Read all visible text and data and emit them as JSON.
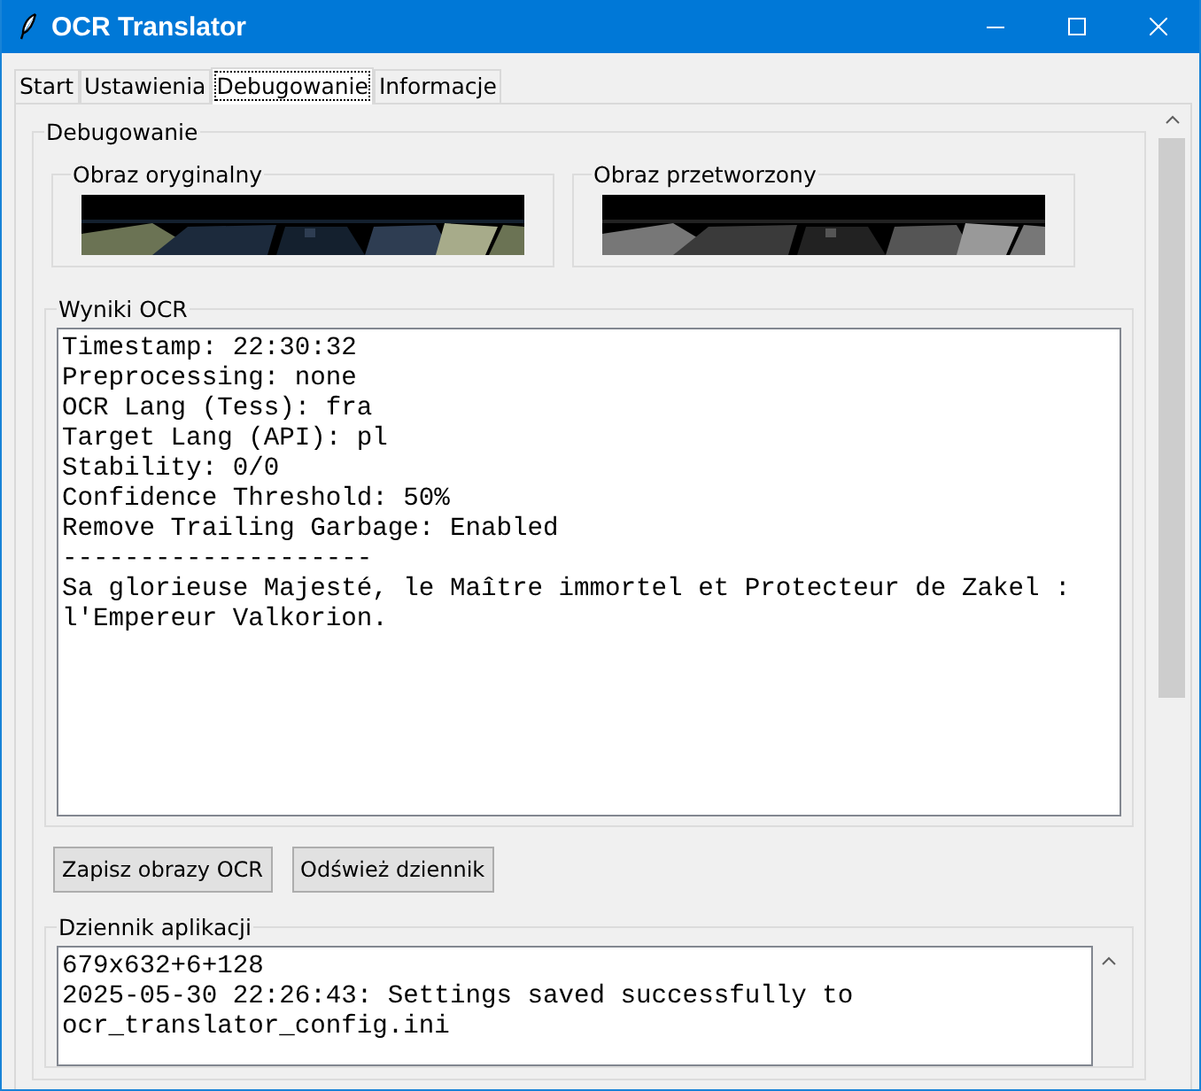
{
  "window": {
    "title": "OCR Translator"
  },
  "tabs": [
    {
      "label": "Start",
      "selected": false
    },
    {
      "label": "Ustawienia",
      "selected": false
    },
    {
      "label": "Debugowanie",
      "selected": true
    },
    {
      "label": "Informacje",
      "selected": false
    }
  ],
  "debug_group": {
    "title": "Debugowanie",
    "previews": [
      {
        "title": "Obraz oryginalny",
        "kind": "picture",
        "grayscale": false
      },
      {
        "title": "Obraz przetworzony",
        "kind": "picture",
        "grayscale": true
      }
    ]
  },
  "ocr_results": {
    "title": "Wyniki OCR",
    "lines": [
      "Timestamp: 22:30:32",
      "Preprocessing: none",
      "OCR Lang (Tess): fra",
      "Target Lang (API): pl",
      "Stability: 0/0",
      "Confidence Threshold: 50%",
      "Remove Trailing Garbage: Enabled",
      "--------------------",
      "Sa glorieuse Majesté, le Maître immortel et Protecteur de Zakel :",
      "l'Empereur Valkorion."
    ]
  },
  "buttons": [
    "Zapisz obrazy OCR",
    "Odśwież dziennik"
  ],
  "app_log": {
    "title": "Dziennik aplikacji",
    "lines": [
      "679x632+6+128",
      "2025-05-30 22:26:43: Settings saved successfully to",
      "ocr_translator_config.ini"
    ]
  }
}
